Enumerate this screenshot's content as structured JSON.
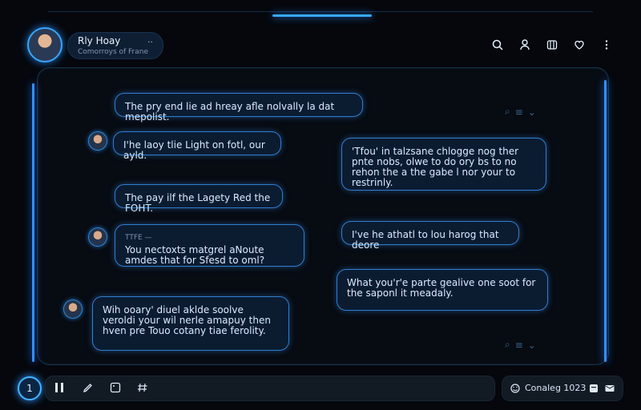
{
  "header": {
    "name": "Rly Hoay",
    "subtitle": "Comorroys of Frane",
    "more": "··"
  },
  "messages": [
    {
      "text": "The pry end lie ad hreay afle nolvally la dat mepolist."
    },
    {
      "text": "I'he laoy tlie Light on fotl, our ayld."
    },
    {
      "text": "'Tfou' in talzsane chlogge nog ther pnte nobs, olwe to do ory bs to no rehon the a the gabe l nor your to restrinly."
    },
    {
      "text": "The pay ilf the Lagety Red the FOHT."
    },
    {
      "meta": "TTFE —",
      "text": "You nectoxts matgrel aNoute amdes that for Sfesd to oml?"
    },
    {
      "text": "I've he athatl to lou harog that deore"
    },
    {
      "text": "What you'r'e parte gealive one soot for the saponl it meadaly."
    },
    {
      "text": "Wih ooary' diuel aklde soolve veroldi your wil nerle amapuy then hven pre Touo cotany tiae ferolity."
    }
  ],
  "footer": {
    "left_badge": "1",
    "status_text": "Conaleg 1023"
  }
}
